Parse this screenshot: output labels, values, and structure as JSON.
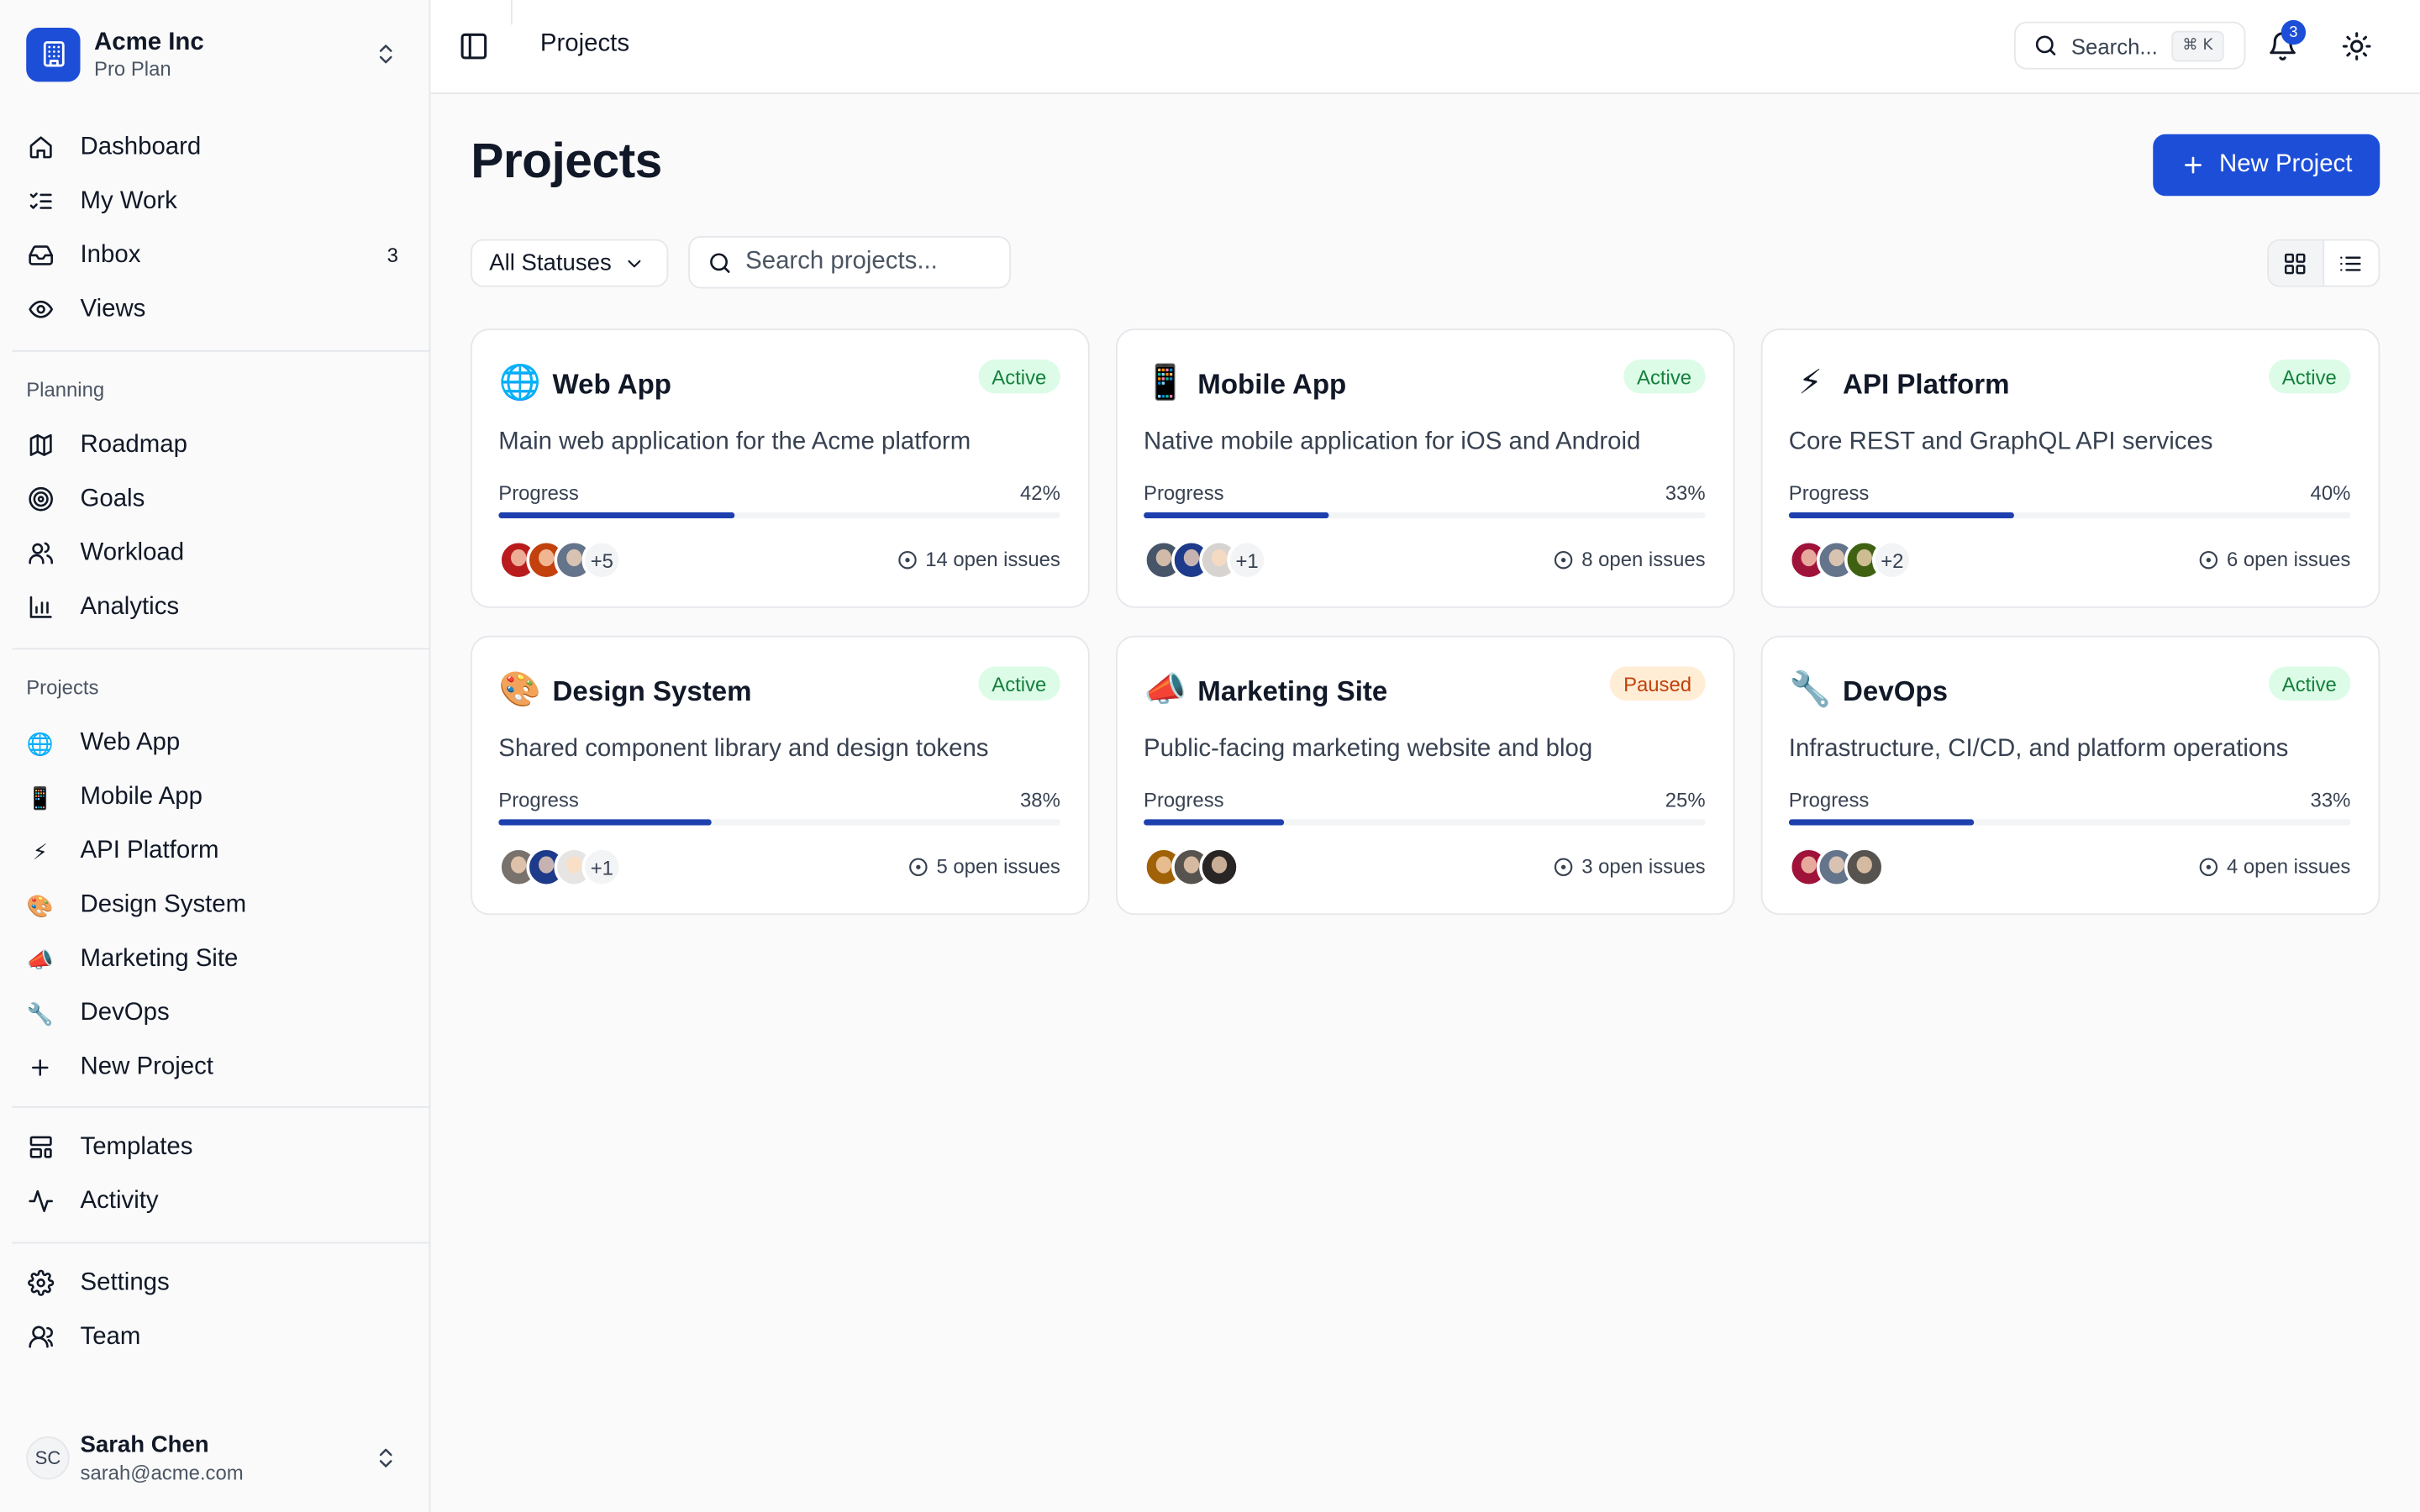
{
  "colors": {
    "accent": "#1d4ed8",
    "progress": "#1e40af",
    "active_bg": "#dcfce7",
    "active_fg": "#15803d",
    "paused_bg": "#ffedd5",
    "paused_fg": "#c2410c"
  },
  "workspace": {
    "name": "Acme Inc",
    "plan": "Pro Plan",
    "logo_icon": "building-icon"
  },
  "nav_main": [
    {
      "label": "Dashboard",
      "icon": "home-icon"
    },
    {
      "label": "My Work",
      "icon": "list-checks-icon"
    },
    {
      "label": "Inbox",
      "icon": "inbox-icon",
      "count": "3"
    },
    {
      "label": "Views",
      "icon": "eye-icon"
    }
  ],
  "planning": {
    "title": "Planning",
    "items": [
      {
        "label": "Roadmap",
        "icon": "map-icon"
      },
      {
        "label": "Goals",
        "icon": "target-icon"
      },
      {
        "label": "Workload",
        "icon": "users-icon"
      },
      {
        "label": "Analytics",
        "icon": "bar-chart-icon"
      }
    ]
  },
  "projects_nav": {
    "title": "Projects",
    "items": [
      {
        "label": "Web App",
        "emoji": "🌐"
      },
      {
        "label": "Mobile App",
        "emoji": "📱"
      },
      {
        "label": "API Platform",
        "emoji": "⚡"
      },
      {
        "label": "Design System",
        "emoji": "🎨"
      },
      {
        "label": "Marketing Site",
        "emoji": "📣"
      },
      {
        "label": "DevOps",
        "emoji": "🔧"
      }
    ],
    "new_label": "New Project"
  },
  "nav_extra": [
    {
      "label": "Templates",
      "icon": "layout-template-icon"
    },
    {
      "label": "Activity",
      "icon": "activity-icon"
    }
  ],
  "nav_bottom": [
    {
      "label": "Settings",
      "icon": "gear-icon"
    },
    {
      "label": "Team",
      "icon": "user-icon"
    }
  ],
  "user": {
    "initials": "SC",
    "name": "Sarah Chen",
    "email": "sarah@acme.com"
  },
  "topbar": {
    "breadcrumb": "Projects",
    "search_label": "Search...",
    "search_shortcut": "⌘ K",
    "notification_count": "3"
  },
  "page": {
    "title": "Projects",
    "new_button": "New Project",
    "status_filter": "All Statuses",
    "search_placeholder": "Search projects..."
  },
  "progress_label": "Progress",
  "projects": [
    {
      "emoji": "🌐",
      "name": "Web App",
      "status": "Active",
      "description": "Main web application for the Acme platform",
      "progress": 42,
      "progress_text": "42%",
      "avatars": [
        "#b91c1c",
        "#c2410c",
        "#64748b"
      ],
      "more": "+5",
      "issues": "14 open issues"
    },
    {
      "emoji": "📱",
      "name": "Mobile App",
      "status": "Active",
      "description": "Native mobile application for iOS and Android",
      "progress": 33,
      "progress_text": "33%",
      "avatars": [
        "#475569",
        "#1e3a8a",
        "#d6d3d1"
      ],
      "more": "+1",
      "issues": "8 open issues"
    },
    {
      "emoji": "⚡",
      "name": "API Platform",
      "status": "Active",
      "description": "Core REST and GraphQL API services",
      "progress": 40,
      "progress_text": "40%",
      "avatars": [
        "#9f1239",
        "#64748b",
        "#3f6212"
      ],
      "more": "+2",
      "issues": "6 open issues"
    },
    {
      "emoji": "🎨",
      "name": "Design System",
      "status": "Active",
      "description": "Shared component library and design tokens",
      "progress": 38,
      "progress_text": "38%",
      "avatars": [
        "#78716c",
        "#1e3a8a",
        "#e7e5e4"
      ],
      "more": "+1",
      "issues": "5 open issues"
    },
    {
      "emoji": "📣",
      "name": "Marketing Site",
      "status": "Paused",
      "description": "Public-facing marketing website and blog",
      "progress": 25,
      "progress_text": "25%",
      "avatars": [
        "#a16207",
        "#57534e",
        "#292524"
      ],
      "more": "",
      "issues": "3 open issues"
    },
    {
      "emoji": "🔧",
      "name": "DevOps",
      "status": "Active",
      "description": "Infrastructure, CI/CD, and platform operations",
      "progress": 33,
      "progress_text": "33%",
      "avatars": [
        "#9f1239",
        "#64748b",
        "#57534e"
      ],
      "more": "",
      "issues": "4 open issues"
    }
  ]
}
